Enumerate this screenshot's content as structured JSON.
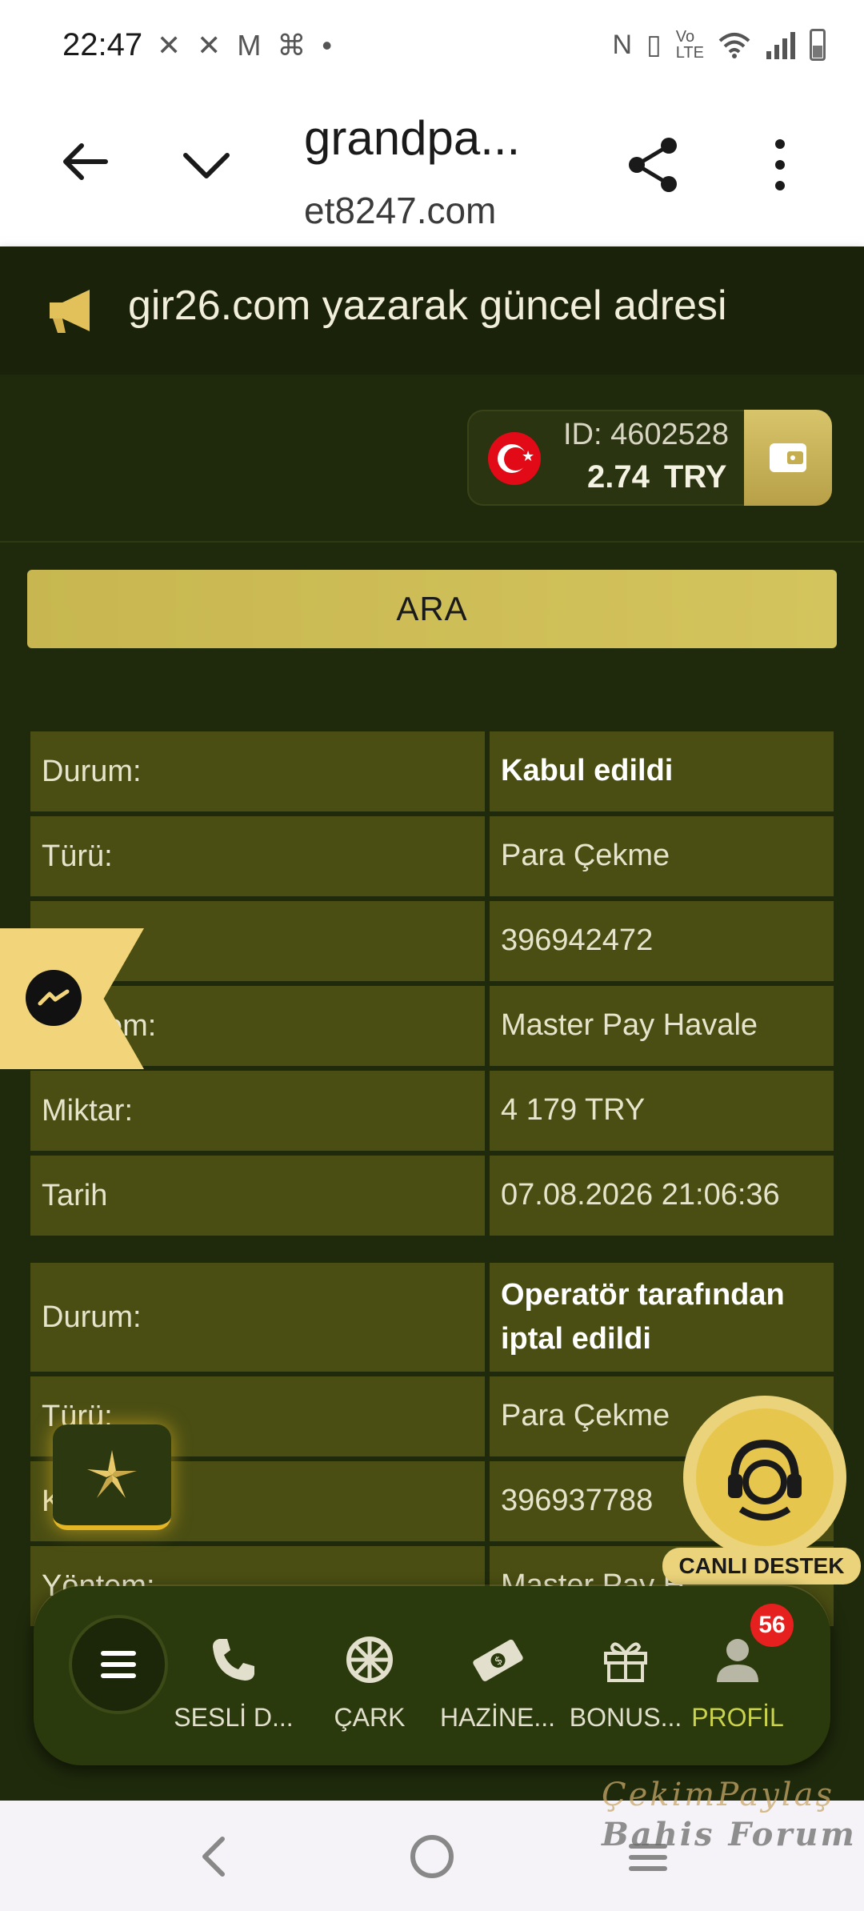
{
  "status_bar": {
    "time": "22:47"
  },
  "browser": {
    "title": "grandpa...",
    "url": "et8247.com"
  },
  "announcement": {
    "text": "gir26.com yazarak güncel adresi"
  },
  "account": {
    "id_label": "ID: 4602528",
    "balance": "2.74",
    "currency": "TRY"
  },
  "search_button": {
    "label": "ARA"
  },
  "transactions": [
    {
      "rows": [
        {
          "label": "Durum:",
          "value": "Kabul edildi",
          "bold": true
        },
        {
          "label": "Türü:",
          "value": "Para Çekme"
        },
        {
          "label": "",
          "value": "396942472"
        },
        {
          "label": "em:",
          "value": "Master Pay Havale"
        },
        {
          "label": "Miktar:",
          "value": "4 179 TRY"
        },
        {
          "label": "Tarih",
          "value": "07.08.2026 21:06:36"
        }
      ]
    },
    {
      "rows": [
        {
          "label": "Durum:",
          "value": "Operatör tarafından iptal edildi",
          "bold": true
        },
        {
          "label": "Türü:",
          "value": "Para Çekme"
        },
        {
          "label": "K",
          "value": "396937788"
        },
        {
          "label": "Yöntem:",
          "value": "Master Pay H"
        }
      ]
    }
  ],
  "live_support": {
    "label": "CANLI DESTEK"
  },
  "bottom_nav": {
    "items": [
      {
        "label": "SESLİ D...",
        "icon": "phone-icon"
      },
      {
        "label": "ÇARK",
        "icon": "wheel-icon"
      },
      {
        "label": "HAZİNE...",
        "icon": "money-icon"
      },
      {
        "label": "BONUS...",
        "icon": "gift-icon"
      },
      {
        "label": "PROFİL",
        "icon": "user-icon",
        "badge": "56"
      }
    ]
  },
  "watermark": {
    "line1": "ÇekimPaylaş",
    "line2": "Bahis Forum"
  },
  "colors": {
    "background": "#1f2a0c",
    "table_cell": "#4a4e13",
    "gold": "#d4c45d",
    "badge": "#e5201f"
  }
}
